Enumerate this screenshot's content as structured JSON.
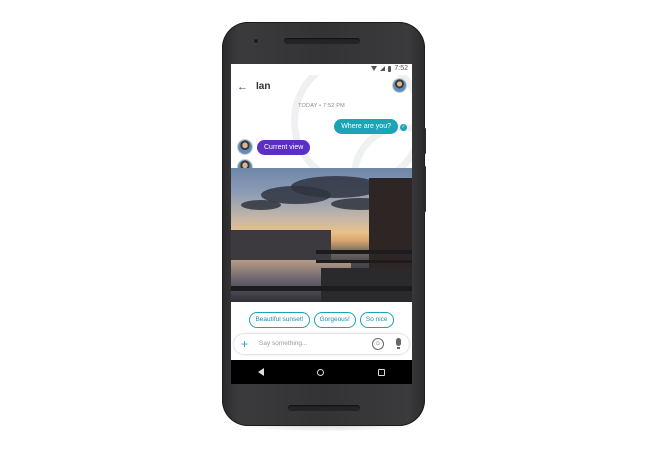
{
  "status_bar": {
    "time": "7:52"
  },
  "header": {
    "back_icon": "arrow-left-icon",
    "contact_name": "Ian"
  },
  "conversation": {
    "timestamp": "TODAY • 7:52 PM",
    "outgoing_message": "Where are you?",
    "incoming_message": "Current view"
  },
  "smart_replies": [
    "Beautiful sunset!",
    "Gorgeous!",
    "So nice"
  ],
  "composer": {
    "placeholder": "Say something..."
  },
  "colors": {
    "teal": "#1ba4b4",
    "purple": "#5b2fc4",
    "nav_bar": "#000000",
    "phone_body": "#333335"
  }
}
